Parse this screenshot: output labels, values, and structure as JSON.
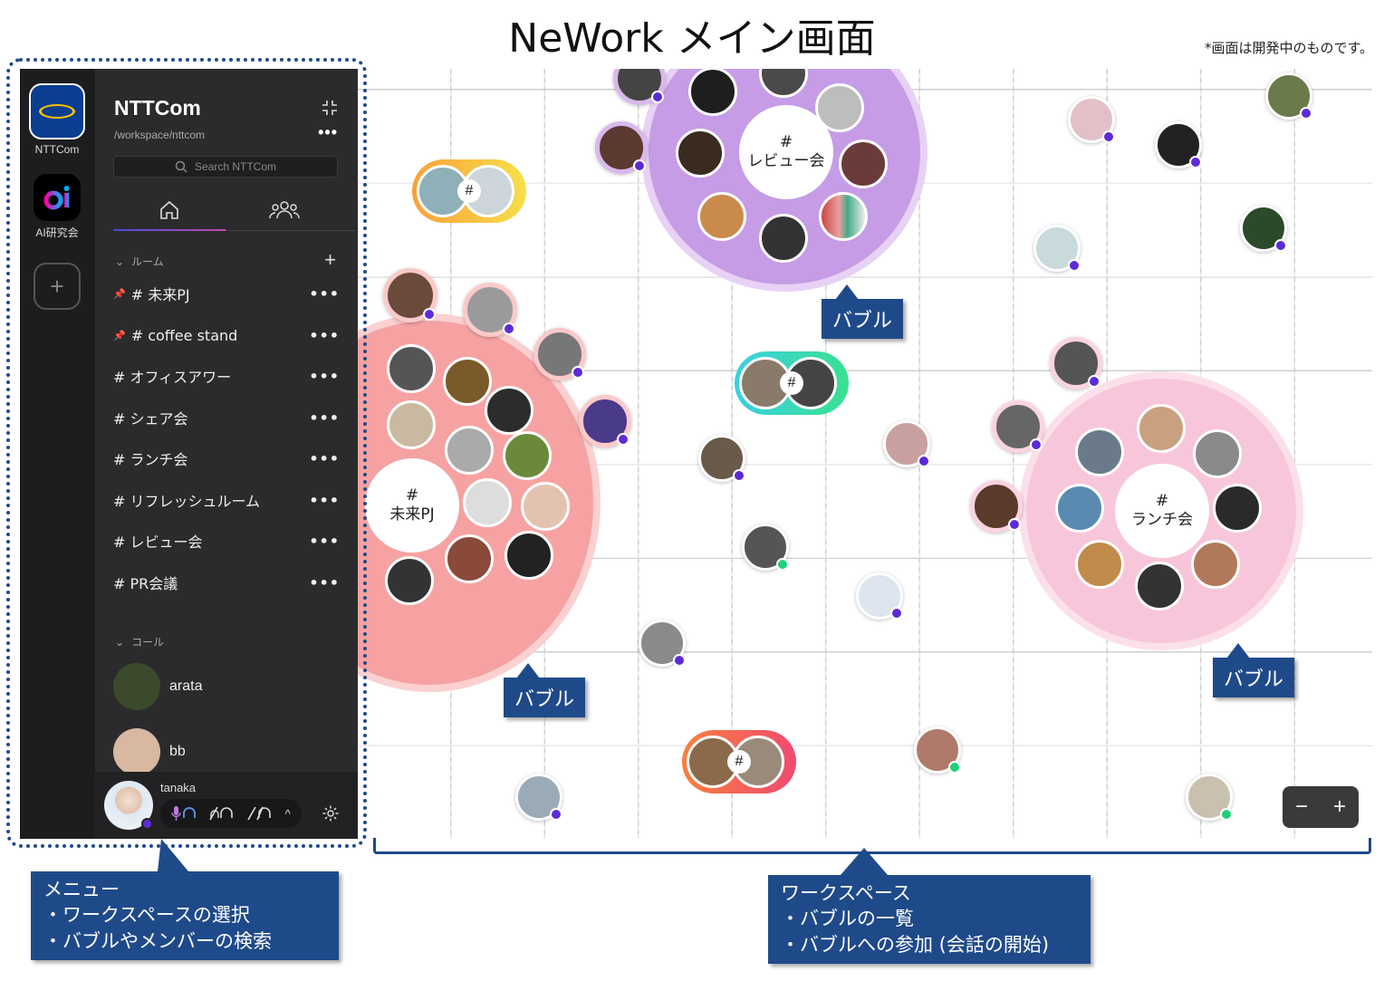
{
  "title": "NeWork メイン画面",
  "dev_note": "*画面は開発中のものです。",
  "sidebar": {
    "rail": [
      {
        "label": "NTTCom",
        "icon": "ntt-logo-icon"
      },
      {
        "label": "AI研究会",
        "icon": "ai-logo-icon"
      }
    ],
    "workspace_name": "NTTCom",
    "workspace_path": "/workspace/nttcom",
    "search_placeholder": "Search NTTCom",
    "rooms_header": "ルーム",
    "rooms": [
      {
        "label": "# 未来PJ",
        "pinned": true
      },
      {
        "label": "# coffee stand",
        "pinned": true
      },
      {
        "label": "# オフィスアワー",
        "pinned": false
      },
      {
        "label": "# シェア会",
        "pinned": false
      },
      {
        "label": "# ランチ会",
        "pinned": false
      },
      {
        "label": "# リフレッシュルーム",
        "pinned": false
      },
      {
        "label": "# レビュー会",
        "pinned": false
      },
      {
        "label": "# PR会議",
        "pinned": false
      }
    ],
    "calls_header": "コール",
    "calls": [
      {
        "name": "arata"
      },
      {
        "name": "bb"
      }
    ],
    "user": "tanaka"
  },
  "workspace": {
    "bubbles": [
      {
        "label_hash": "#",
        "label": "レビュー会"
      },
      {
        "label_hash": "#",
        "label": "未来PJ"
      },
      {
        "label_hash": "#",
        "label": "ランチ会"
      }
    ],
    "pair_hash": "#"
  },
  "callouts": {
    "bubble": "バブル",
    "menu": [
      "メニュー",
      "・ワークスペースの選択",
      "・バブルやメンバーの検索"
    ],
    "workspace": [
      "ワークスペース",
      "・バブルの一覧",
      "・バブルへの参加 (会話の開始)"
    ]
  },
  "zoom": {
    "minus": "−",
    "plus": "+"
  },
  "colors": {
    "callout": "#1f4a8a",
    "sidebar": "#2b2b2d",
    "review_bubble": "#c9a0e6",
    "mirai_bubble": "#f6a6a6",
    "lunch_bubble": "#f9c8dc"
  }
}
